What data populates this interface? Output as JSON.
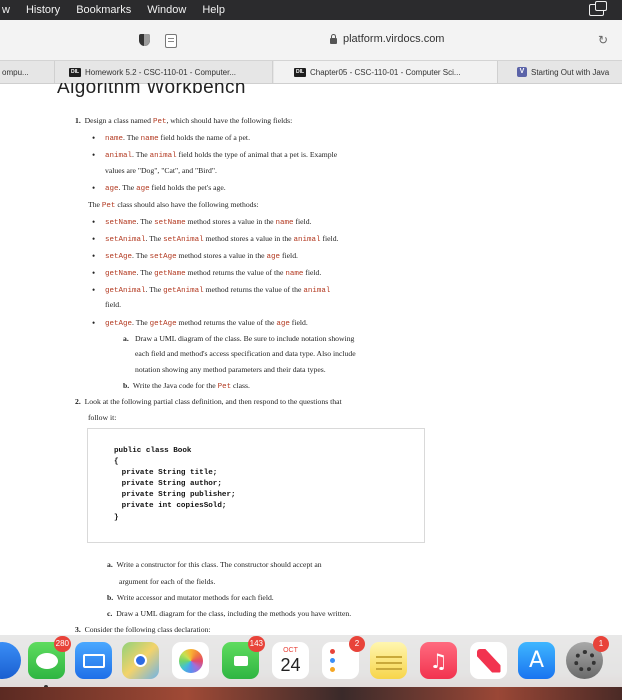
{
  "menubar": {
    "items": [
      "w",
      "History",
      "Bookmarks",
      "Window",
      "Help"
    ]
  },
  "toolbar": {
    "url": "platform.virdocs.com"
  },
  "tabs": [
    {
      "label": "ompu...",
      "favicon": ""
    },
    {
      "label": "Homework 5.2 - CSC-110-01 - Computer...",
      "favicon": "DIL"
    },
    {
      "label": "Chapter05 - CSC-110-01 - Computer Sci...",
      "favicon": "DIL"
    },
    {
      "label": "Starting Out with Java",
      "favicon": "V"
    }
  ],
  "document": {
    "title": "Algorithm Workbench",
    "q1": {
      "num": "1.",
      "intro": "Design a class named",
      "class_name": "Pet",
      "intro_tail": ", which should have the following fields:",
      "fields": [
        {
          "name": "name",
          "mid": ". The",
          "name2": "name",
          "tail": "field holds the name of a pet."
        },
        {
          "name": "animal",
          "mid": ". The",
          "name2": "animal",
          "tail": "field holds the type of animal that a pet is. Example"
        },
        {
          "name": "age",
          "mid": ". The",
          "name2": "age",
          "tail": "field holds the pet's age."
        }
      ],
      "animal_cont": "values are \"Dog\", \"Cat\", and \"Bird\".",
      "methods_intro_pre": "The",
      "methods_intro_class": "Pet",
      "methods_intro_tail": "class should also have the following methods:",
      "methods": [
        {
          "name": "setName",
          "mid": ". The",
          "name2": "setName",
          "tail": "method stores a value in the",
          "field": "name",
          "end": "field."
        },
        {
          "name": "setAnimal",
          "mid": ". The",
          "name2": "setAnimal",
          "tail": "method stores a value in the",
          "field": "animal",
          "end": "field."
        },
        {
          "name": "setAge",
          "mid": ". The",
          "name2": "setAge",
          "tail": "method stores a value in the",
          "field": "age",
          "end": "field."
        },
        {
          "name": "getName",
          "mid": ". The",
          "name2": "getName",
          "tail": "method returns the value of the",
          "field": "name",
          "end": "field."
        },
        {
          "name": "getAnimal",
          "mid": ". The",
          "name2": "getAnimal",
          "tail": "method returns the value of the",
          "field": "animal",
          "end": ""
        },
        {
          "name": "getAge",
          "mid": ". The",
          "name2": "getAge",
          "tail": "method returns the value of the",
          "field": "age",
          "end": "field."
        }
      ],
      "getanimal_cont": "field.",
      "sub_a_label": "a.",
      "sub_a": [
        "Draw a UML diagram of the class. Be sure to include notation showing",
        "each field and method's access specification and data type. Also include",
        "notation showing any method parameters and their data types."
      ],
      "sub_b_label": "b.",
      "sub_b_pre": "Write the Java code for the",
      "sub_b_class": "Pet",
      "sub_b_tail": "class."
    },
    "q2": {
      "num": "2.",
      "lines": [
        "Look at the following partial class definition, and then respond to the questions that",
        "follow it:"
      ],
      "code": [
        "public class Book",
        "{",
        "   private String title;",
        "   private String author;",
        "   private String publisher;",
        "   private int copiesSold;",
        "}"
      ],
      "sub": [
        {
          "label": "a.",
          "lines": [
            "Write a constructor for this class. The constructor should accept an",
            "argument for each of the fields."
          ]
        },
        {
          "label": "b.",
          "lines": [
            "Write accessor and mutator methods for each field."
          ]
        },
        {
          "label": "c.",
          "lines": [
            "Draw a UML diagram for the class, including the methods you have written."
          ]
        }
      ]
    },
    "q3": {
      "num": "3.",
      "text": "Consider the following class declaration:"
    }
  },
  "dock": {
    "messages_badge": "280",
    "facetime_badge": "143",
    "calendar_month": "OCT",
    "calendar_day": "24",
    "reminders_badge": "2",
    "settings_badge": "1"
  }
}
